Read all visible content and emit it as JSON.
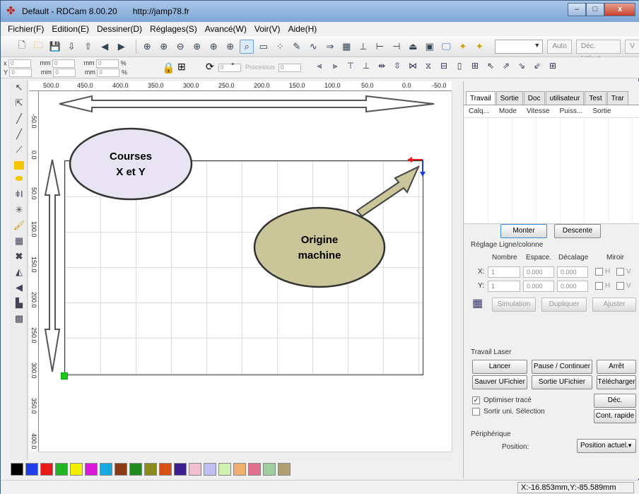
{
  "titlebar": {
    "title": "Default - RDCam 8.00.20",
    "url": "http://jamp78.fr",
    "min": "–",
    "max": "□",
    "close": "x"
  },
  "menu": [
    "Fichier(F)",
    "Edition(E)",
    "Dessiner(D)",
    "Réglages(S)",
    "Avancé(W)",
    "Voir(V)",
    "Aide(H)"
  ],
  "toolbar": {
    "combo_value": "",
    "auto": "Auto",
    "dec": "Déc. Int/ext",
    "v": "V"
  },
  "toolbar2": {
    "x_label": "x",
    "y_label": "Y",
    "x_val": "0",
    "y_val": "0",
    "unit": "mm",
    "pct": "%",
    "rot_val": "0",
    "deg": "°",
    "processus": "Processus",
    "proc_val": "0"
  },
  "ruler": {
    "h": [
      "500.0",
      "450.0",
      "400.0",
      "350.0",
      "300.0",
      "250.0",
      "200.0",
      "150.0",
      "100.0",
      "50.0",
      "0.0",
      "-50.0"
    ],
    "v": [
      "-50.0",
      "0.0",
      "50.0",
      "100.0",
      "150.0",
      "200.0",
      "250.0",
      "300.0",
      "350.0",
      "400.0"
    ]
  },
  "overlay": {
    "courses": "Courses\nX et Y",
    "origine": "Origine\nmachine"
  },
  "panel": {
    "tabs": [
      "Travail",
      "Sortie",
      "Doc",
      "utilisateur",
      "Test",
      "Trar"
    ],
    "columns": [
      "Calq...",
      "Mode",
      "Vitesse",
      "Puiss...",
      "Sortie"
    ],
    "monter": "Monter",
    "descente": "Descente",
    "reglage": "Réglage Ligne/colonne",
    "nombre": "Nombre",
    "espace": "Espace.",
    "decalage": "Décalage",
    "miroir": "Miroir",
    "x": "X:",
    "y": "Y:",
    "one": "1",
    "zero": "0.000",
    "h": "H",
    "v": "V",
    "simulation": "Simulation",
    "dupliquer": "Dupliquer",
    "ajuster": "Ajuster",
    "travail_laser": "Travail Laser",
    "lancer": "Lancer",
    "pause": "Pause / Continuer",
    "arret": "Arrêt",
    "sauver": "Sauver UFichier",
    "sortie_uf": "Sortie UFichier",
    "telecharger": "Télécharger",
    "optimiser": "Optimiser tracé",
    "dec_contour": "Déc. Contour",
    "sortir": "Sortir uni. Sélection",
    "cont_rapide": "Cont. rapide",
    "peripherique": "Périphérique",
    "position": "Position:",
    "position_val": "Position actuel."
  },
  "palette": [
    "#000000",
    "#1e3ee8",
    "#e81818",
    "#22b422",
    "#f0f000",
    "#d818d8",
    "#18a8e0",
    "#8c3c14",
    "#208c20",
    "#8c8c1e",
    "#d85014",
    "#3c1e8c",
    "#f0c0d0",
    "#c0c0f0",
    "#d0f0b0",
    "#f0b070",
    "#e07090",
    "#a0d0a0",
    "#b0a070"
  ],
  "status": {
    "coord": "X:-16.853mm,Y:-85.589mm"
  },
  "colors": {
    "accent": "#3a6ea5",
    "bubble_fill": "#e9e4f3",
    "bubble_fill2": "#cbc59a",
    "origin_green": "#1ec71e"
  }
}
